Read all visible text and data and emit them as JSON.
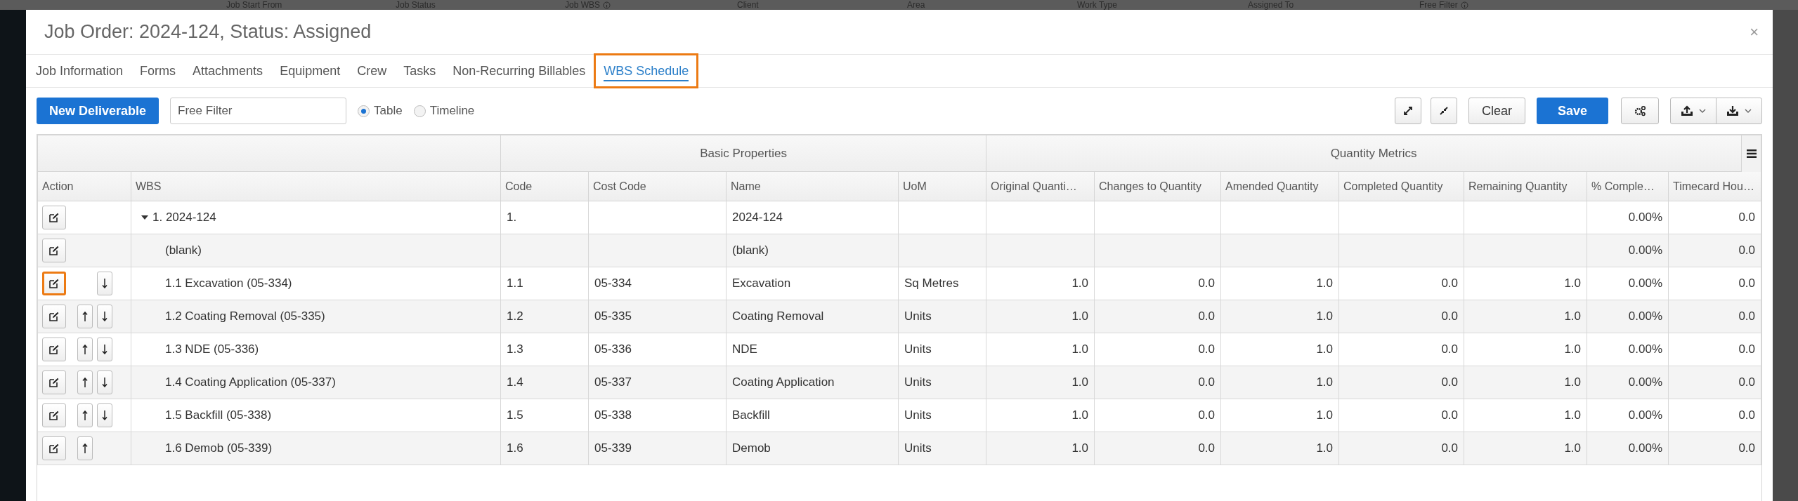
{
  "background_page": {
    "filter_labels": [
      {
        "label": "Job Start From",
        "info": false
      },
      {
        "label": "Job Status",
        "info": false
      },
      {
        "label": "Job WBS",
        "info": true
      },
      {
        "label": "Client",
        "info": false
      },
      {
        "label": "Area",
        "info": false
      },
      {
        "label": "Work Type",
        "info": false
      },
      {
        "label": "Assigned To",
        "info": false
      },
      {
        "label": "Free Filter",
        "info": true
      }
    ]
  },
  "dialog": {
    "title": "Job Order: 2024-124, Status: Assigned",
    "close": "×"
  },
  "tabs": [
    {
      "label": "Job Information",
      "selected": false,
      "highlighted": false
    },
    {
      "label": "Forms",
      "selected": false,
      "highlighted": false
    },
    {
      "label": "Attachments",
      "selected": false,
      "highlighted": false
    },
    {
      "label": "Equipment",
      "selected": false,
      "highlighted": false
    },
    {
      "label": "Crew",
      "selected": false,
      "highlighted": false
    },
    {
      "label": "Tasks",
      "selected": false,
      "highlighted": false
    },
    {
      "label": "Non-Recurring Billables",
      "selected": false,
      "highlighted": false
    },
    {
      "label": "WBS Schedule",
      "selected": true,
      "highlighted": true
    }
  ],
  "toolbar": {
    "new_button": "New Deliverable",
    "filter": {
      "placeholder": "Free Filter"
    },
    "views": [
      {
        "label": "Table",
        "selected": true
      },
      {
        "label": "Timeline",
        "selected": false
      }
    ],
    "clear_button": "Clear",
    "save_button": "Save"
  },
  "table": {
    "column_groups": [
      "Basic Properties",
      "Quantity Metrics"
    ],
    "columns": [
      "Action",
      "WBS",
      "Code",
      "Cost Code",
      "Name",
      "UoM",
      "Original Quanti…",
      "Changes to Quantity",
      "Amended Quantity",
      "Completed Quantity",
      "Remaining Quantity",
      "% Comple…",
      "Timecard Hou…"
    ],
    "rows": [
      {
        "wbs": "1. 2024-124",
        "expanded": true,
        "move_up": false,
        "move_down": false,
        "highlighted": false,
        "code": "1.",
        "name": "2024-124",
        "percent_complete": "0.00%",
        "timecard_hours": "0.0",
        "children": [
          {
            "wbs": "(blank)",
            "move_up": false,
            "move_down": false,
            "highlighted": false,
            "name": "(blank)",
            "percent_complete": "0.00%",
            "timecard_hours": "0.0"
          },
          {
            "wbs": "1.1 Excavation (05-334)",
            "move_up": false,
            "move_down": true,
            "highlighted": true,
            "code": "1.1",
            "cost_code": "05-334",
            "name": "Excavation",
            "uom": "Sq Metres",
            "original_quantity": "1.0",
            "changes_to_quantity": "0.0",
            "amended_quantity": "1.0",
            "completed_quantity": "0.0",
            "remaining_quantity": "1.0",
            "percent_complete": "0.00%",
            "timecard_hours": "0.0"
          },
          {
            "wbs": "1.2 Coating Removal (05-335)",
            "move_up": true,
            "move_down": true,
            "highlighted": false,
            "code": "1.2",
            "cost_code": "05-335",
            "name": "Coating Removal",
            "uom": "Units",
            "original_quantity": "1.0",
            "changes_to_quantity": "0.0",
            "amended_quantity": "1.0",
            "completed_quantity": "0.0",
            "remaining_quantity": "1.0",
            "percent_complete": "0.00%",
            "timecard_hours": "0.0"
          },
          {
            "wbs": "1.3 NDE (05-336)",
            "move_up": true,
            "move_down": true,
            "highlighted": false,
            "code": "1.3",
            "cost_code": "05-336",
            "name": "NDE",
            "uom": "Units",
            "original_quantity": "1.0",
            "changes_to_quantity": "0.0",
            "amended_quantity": "1.0",
            "completed_quantity": "0.0",
            "remaining_quantity": "1.0",
            "percent_complete": "0.00%",
            "timecard_hours": "0.0"
          },
          {
            "wbs": "1.4 Coating Application (05-337)",
            "move_up": true,
            "move_down": true,
            "highlighted": false,
            "code": "1.4",
            "cost_code": "05-337",
            "name": "Coating Application",
            "uom": "Units",
            "original_quantity": "1.0",
            "changes_to_quantity": "0.0",
            "amended_quantity": "1.0",
            "completed_quantity": "0.0",
            "remaining_quantity": "1.0",
            "percent_complete": "0.00%",
            "timecard_hours": "0.0"
          },
          {
            "wbs": "1.5 Backfill (05-338)",
            "move_up": true,
            "move_down": true,
            "highlighted": false,
            "code": "1.5",
            "cost_code": "05-338",
            "name": "Backfill",
            "uom": "Units",
            "original_quantity": "1.0",
            "changes_to_quantity": "0.0",
            "amended_quantity": "1.0",
            "completed_quantity": "0.0",
            "remaining_quantity": "1.0",
            "percent_complete": "0.00%",
            "timecard_hours": "0.0"
          },
          {
            "wbs": "1.6 Demob (05-339)",
            "move_up": true,
            "move_down": false,
            "highlighted": false,
            "code": "1.6",
            "cost_code": "05-339",
            "name": "Demob",
            "uom": "Units",
            "original_quantity": "1.0",
            "changes_to_quantity": "0.0",
            "amended_quantity": "1.0",
            "completed_quantity": "0.0",
            "remaining_quantity": "1.0",
            "percent_complete": "0.00%",
            "timecard_hours": "0.0"
          }
        ]
      }
    ]
  }
}
